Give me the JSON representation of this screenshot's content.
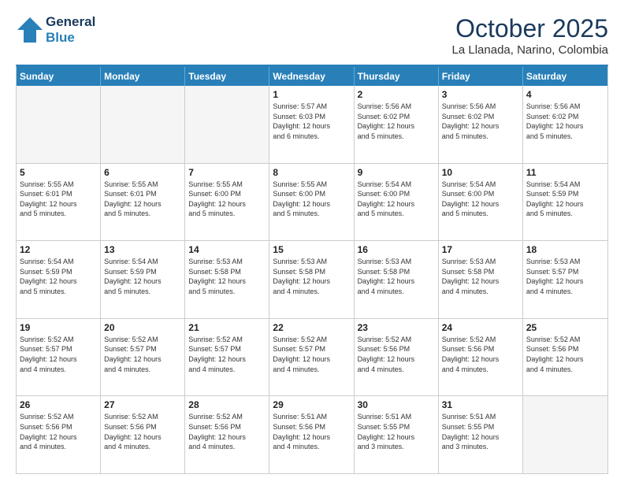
{
  "logo": {
    "line1": "General",
    "line2": "Blue"
  },
  "title": "October 2025",
  "location": "La Llanada, Narino, Colombia",
  "weekdays": [
    "Sunday",
    "Monday",
    "Tuesday",
    "Wednesday",
    "Thursday",
    "Friday",
    "Saturday"
  ],
  "weeks": [
    [
      {
        "day": "",
        "info": ""
      },
      {
        "day": "",
        "info": ""
      },
      {
        "day": "",
        "info": ""
      },
      {
        "day": "1",
        "info": "Sunrise: 5:57 AM\nSunset: 6:03 PM\nDaylight: 12 hours\nand 6 minutes."
      },
      {
        "day": "2",
        "info": "Sunrise: 5:56 AM\nSunset: 6:02 PM\nDaylight: 12 hours\nand 5 minutes."
      },
      {
        "day": "3",
        "info": "Sunrise: 5:56 AM\nSunset: 6:02 PM\nDaylight: 12 hours\nand 5 minutes."
      },
      {
        "day": "4",
        "info": "Sunrise: 5:56 AM\nSunset: 6:02 PM\nDaylight: 12 hours\nand 5 minutes."
      }
    ],
    [
      {
        "day": "5",
        "info": "Sunrise: 5:55 AM\nSunset: 6:01 PM\nDaylight: 12 hours\nand 5 minutes."
      },
      {
        "day": "6",
        "info": "Sunrise: 5:55 AM\nSunset: 6:01 PM\nDaylight: 12 hours\nand 5 minutes."
      },
      {
        "day": "7",
        "info": "Sunrise: 5:55 AM\nSunset: 6:00 PM\nDaylight: 12 hours\nand 5 minutes."
      },
      {
        "day": "8",
        "info": "Sunrise: 5:55 AM\nSunset: 6:00 PM\nDaylight: 12 hours\nand 5 minutes."
      },
      {
        "day": "9",
        "info": "Sunrise: 5:54 AM\nSunset: 6:00 PM\nDaylight: 12 hours\nand 5 minutes."
      },
      {
        "day": "10",
        "info": "Sunrise: 5:54 AM\nSunset: 6:00 PM\nDaylight: 12 hours\nand 5 minutes."
      },
      {
        "day": "11",
        "info": "Sunrise: 5:54 AM\nSunset: 5:59 PM\nDaylight: 12 hours\nand 5 minutes."
      }
    ],
    [
      {
        "day": "12",
        "info": "Sunrise: 5:54 AM\nSunset: 5:59 PM\nDaylight: 12 hours\nand 5 minutes."
      },
      {
        "day": "13",
        "info": "Sunrise: 5:54 AM\nSunset: 5:59 PM\nDaylight: 12 hours\nand 5 minutes."
      },
      {
        "day": "14",
        "info": "Sunrise: 5:53 AM\nSunset: 5:58 PM\nDaylight: 12 hours\nand 5 minutes."
      },
      {
        "day": "15",
        "info": "Sunrise: 5:53 AM\nSunset: 5:58 PM\nDaylight: 12 hours\nand 4 minutes."
      },
      {
        "day": "16",
        "info": "Sunrise: 5:53 AM\nSunset: 5:58 PM\nDaylight: 12 hours\nand 4 minutes."
      },
      {
        "day": "17",
        "info": "Sunrise: 5:53 AM\nSunset: 5:58 PM\nDaylight: 12 hours\nand 4 minutes."
      },
      {
        "day": "18",
        "info": "Sunrise: 5:53 AM\nSunset: 5:57 PM\nDaylight: 12 hours\nand 4 minutes."
      }
    ],
    [
      {
        "day": "19",
        "info": "Sunrise: 5:52 AM\nSunset: 5:57 PM\nDaylight: 12 hours\nand 4 minutes."
      },
      {
        "day": "20",
        "info": "Sunrise: 5:52 AM\nSunset: 5:57 PM\nDaylight: 12 hours\nand 4 minutes."
      },
      {
        "day": "21",
        "info": "Sunrise: 5:52 AM\nSunset: 5:57 PM\nDaylight: 12 hours\nand 4 minutes."
      },
      {
        "day": "22",
        "info": "Sunrise: 5:52 AM\nSunset: 5:57 PM\nDaylight: 12 hours\nand 4 minutes."
      },
      {
        "day": "23",
        "info": "Sunrise: 5:52 AM\nSunset: 5:56 PM\nDaylight: 12 hours\nand 4 minutes."
      },
      {
        "day": "24",
        "info": "Sunrise: 5:52 AM\nSunset: 5:56 PM\nDaylight: 12 hours\nand 4 minutes."
      },
      {
        "day": "25",
        "info": "Sunrise: 5:52 AM\nSunset: 5:56 PM\nDaylight: 12 hours\nand 4 minutes."
      }
    ],
    [
      {
        "day": "26",
        "info": "Sunrise: 5:52 AM\nSunset: 5:56 PM\nDaylight: 12 hours\nand 4 minutes."
      },
      {
        "day": "27",
        "info": "Sunrise: 5:52 AM\nSunset: 5:56 PM\nDaylight: 12 hours\nand 4 minutes."
      },
      {
        "day": "28",
        "info": "Sunrise: 5:52 AM\nSunset: 5:56 PM\nDaylight: 12 hours\nand 4 minutes."
      },
      {
        "day": "29",
        "info": "Sunrise: 5:51 AM\nSunset: 5:56 PM\nDaylight: 12 hours\nand 4 minutes."
      },
      {
        "day": "30",
        "info": "Sunrise: 5:51 AM\nSunset: 5:55 PM\nDaylight: 12 hours\nand 3 minutes."
      },
      {
        "day": "31",
        "info": "Sunrise: 5:51 AM\nSunset: 5:55 PM\nDaylight: 12 hours\nand 3 minutes."
      },
      {
        "day": "",
        "info": ""
      }
    ]
  ]
}
